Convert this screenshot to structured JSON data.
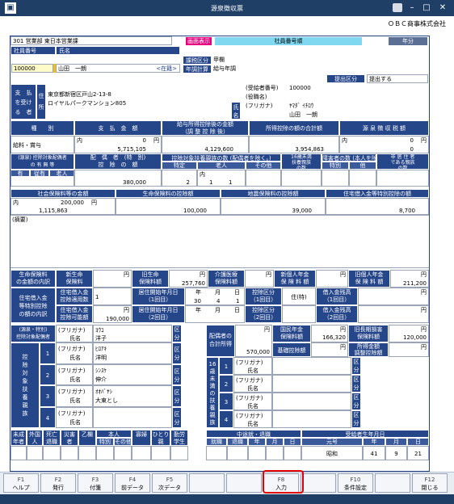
{
  "window": {
    "title": "源泉徴収票",
    "company": "ＯＢＣ商事株式会社"
  },
  "header": {
    "dept": "301 営業部 東日本営業課",
    "btn_screen": "画面表示",
    "emp_order": "社員番号順",
    "year": "年分",
    "label_emp_no": "社員番号",
    "label_name": "氏名",
    "emp_no": "100000",
    "emp_name": "山田　一朗",
    "status": "<在籍>",
    "label_tax_class": "課税区分",
    "tax_class": "甲欄",
    "label_year_adj": "年調計算",
    "year_adj": "給与年調",
    "label_submit": "提出区分",
    "submit": "提出する"
  },
  "payee": {
    "label_side": "支　払\nを受け\nる　者",
    "label_addr": "住\n所",
    "addr1": "東京都新宿区戸山2-13-8",
    "addr2": "ロイヤルパークマンション805",
    "label_recipient_no": "(受給者番号)",
    "recipient_no": "100000",
    "label_post": "(役職名)",
    "label_name": "氏\n名",
    "label_kana": "(フリガナ)",
    "kana": "ﾔﾏﾀﾞ ｲﾁﾛｳ",
    "name": "山田　一朗"
  },
  "pay": {
    "h_kind": "種　　別",
    "h_amount": "支　払　金　額",
    "h_deducted": "給与所得控除後の金額\n（調 整 控 除 後）",
    "h_deductions_total": "所得控除の額の合計額",
    "h_tax": "源 泉 徴 収 税 額",
    "kind": "給料・賞与",
    "unit_uchi": "内",
    "unit_yen": "円",
    "amount_uchi": "0",
    "amount": "5,715,105",
    "deducted": "4,129,600",
    "deductions_total": "3,954,863",
    "tax_uchi": "0",
    "tax": "0"
  },
  "dep": {
    "h_spouse": "(源泉) 控除対象配偶者\nの 有 無 等",
    "h_spouse_special": "配　偶　者　(特　別)\n控　除　の　額",
    "h_dependents": "控除対象扶養親族の数\n(配偶者を除く。)",
    "h_under16": "16歳未満\n扶養親族\nの数",
    "h_disabled": "障害者の数\n(本人を除く。)",
    "h_nonresident": "非 居 住 者\nである親族\nの数",
    "s_yes": "有",
    "s_jyuu": "従有",
    "s_elderly": "老人",
    "s_special": "特定",
    "s_elderly2": "老人",
    "s_other": "その他",
    "s_spec2": "特別",
    "s_other2": "他",
    "u_nin": "人",
    "u_jyuunin": "従人",
    "u_uchi": "内",
    "spouse_special_amount": "380,000",
    "special_count": "2",
    "elderly_uchi": "1",
    "elderly_count": "1"
  },
  "ins": {
    "h_social": "社会保険料等の金額",
    "h_life": "生命保険料の控除額",
    "h_quake": "地震保険料の控除額",
    "h_loan": "住宅借入金等特別控除の額",
    "social_uchi": "200,000",
    "social": "1,115,863",
    "life": "100,000",
    "quake": "39,000",
    "loan": "8,700",
    "label_remarks": "(摘要)"
  },
  "bottom": {
    "h_life_breakdown": "生命保険料\nの金額の内訳",
    "h_new_life": "新生命\n保険料",
    "new_life": "",
    "h_old_life": "旧生命\n保険料額",
    "old_life": "257,760",
    "h_care": "介護医療\n保険料額",
    "care": "",
    "h_new_pension": "新個人年金\n保 険 料 額",
    "new_pension": "",
    "h_old_pension": "旧個人年金\n保 険 料 額",
    "old_pension": "211,200",
    "h_loan_breakdown": "住宅借入金\n等特別控除\nの額の内訳",
    "h_loan_applied": "住宅借入金\n控除適用数",
    "loan_applied": "1",
    "h_start1": "居住開始年月日\n（1回目）",
    "start1_y": "30",
    "start1_m": "4",
    "start1_d": "1",
    "h_class1": "控除区分\n（1回目）",
    "class1": "住(特)",
    "h_balance1": "借入金残高\n（1回目）",
    "balance1": "",
    "h_loan_possible": "住宅借入金\n控除可能額",
    "loan_possible": "190,000",
    "h_start2": "居住開始年月日\n（2回目）",
    "h_class2": "控除区分\n（2回目）",
    "h_balance2": "借入金残高\n（2回目）",
    "u_year": "年",
    "u_month": "月",
    "u_day": "日"
  },
  "spouse_sec": {
    "h": "(源泉・特別)\n控除対象配偶者",
    "label_kana": "(フリガナ)",
    "label_name": "氏名",
    "label_class": "区\n分",
    "kana": "ﾖｳｺ",
    "name": "洋子",
    "h_spouse_income": "配偶者の\n合計所得",
    "spouse_income": "570,000",
    "h_national_pension": "国民年金\n保険料額",
    "national_pension": "166,320",
    "h_old_long": "旧長期損害\n保険料額",
    "old_long": "120,000",
    "h_basic": "基礎控除額",
    "basic": "",
    "h_adjust": "所得金額\n調整控除額",
    "adjust": ""
  },
  "dependents": {
    "side": "控\n除\n対\n象\n扶\n養\n親\n族",
    "rows": [
      {
        "no": "1",
        "kana": "ﾋﾛｱｷ",
        "name": "洋明"
      },
      {
        "no": "2",
        "kana": "ｼﾝｽｹ",
        "name": "伸介"
      },
      {
        "no": "3",
        "kana": "ｵｵﾊﾞﾔｼ",
        "name": "大東とし"
      },
      {
        "no": "4",
        "kana": "",
        "name": ""
      }
    ],
    "u16_side": "16\n歳\n未\n満\nの\n扶\n養\n親\n族",
    "u16_rows": [
      {
        "no": "1"
      },
      {
        "no": "2"
      },
      {
        "no": "3"
      },
      {
        "no": "4"
      }
    ]
  },
  "footer": {
    "h_minor": "未成\n年者",
    "h_foreign": "外国\n人",
    "h_death": "死亡\n退職",
    "h_disaster": "災害\n者",
    "h_b": "乙欄",
    "h_self": "本人",
    "h_special": "特別",
    "h_other": "その他",
    "h_widow": "寡婦",
    "h_single": "ひとり\n親",
    "h_student": "勤労\n学生",
    "h_midjob": "中途就・退職",
    "h_job": "就職",
    "h_ret": "退職",
    "h_y": "年",
    "h_m": "月",
    "h_d": "日",
    "h_birth": "受給者生年月日",
    "h_era": "元号",
    "era": "昭和",
    "by": "41",
    "bm": "9",
    "bd": "21"
  },
  "fkeys": [
    {
      "key": "F1",
      "label": "ヘルプ"
    },
    {
      "key": "F2",
      "label": "発行"
    },
    {
      "key": "F3",
      "label": "付箋"
    },
    {
      "key": "F4",
      "label": "前データ"
    },
    {
      "key": "F5",
      "label": "次データ"
    },
    {
      "key": "",
      "label": ""
    },
    {
      "key": "",
      "label": ""
    },
    {
      "key": "F8",
      "label": "入力"
    },
    {
      "key": "",
      "label": ""
    },
    {
      "key": "F10",
      "label": "条件設定"
    },
    {
      "key": "",
      "label": ""
    },
    {
      "key": "F12",
      "label": "閉じる"
    }
  ]
}
